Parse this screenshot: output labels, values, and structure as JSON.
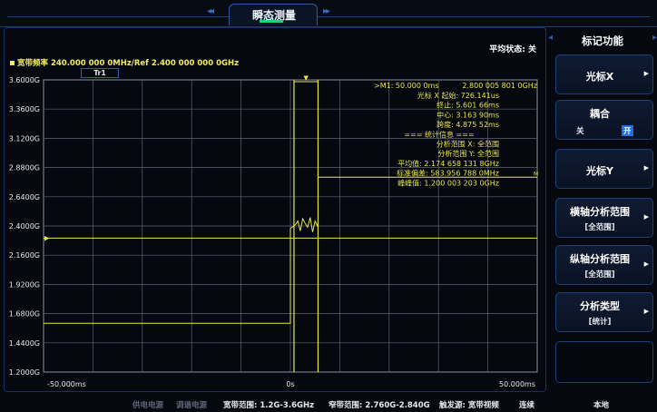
{
  "window": {
    "title": "瞬态测量"
  },
  "chart_header": {
    "avg_status": "平均状态: 关",
    "span_text": "宽带频率 240.000 000 0MHz/Ref 2.400 000 000 0GHz",
    "trace_label": "Tr1"
  },
  "chart_data": {
    "type": "line",
    "y_ticks": [
      "3.6000G",
      "3.3600G",
      "3.1200G",
      "2.8800G",
      "2.6400G",
      "2.4000G",
      "2.1600G",
      "1.9200G",
      "1.6800G",
      "1.4400G",
      "1.2000G"
    ],
    "x_ticks": [
      "-50.000ms",
      "0s",
      "50.000ms"
    ],
    "x_range_ms": [
      -50,
      50
    ],
    "y_range_ghz": [
      1.2,
      3.6
    ],
    "grid": true,
    "reference_line_ghz": 2.3,
    "series": [
      {
        "x_ms": [
          -50,
          0,
          0,
          1,
          1.5,
          2,
          2.5,
          3,
          3.5,
          4,
          4.5,
          5,
          5.5,
          5.6,
          5.6,
          50
        ],
        "y_ghz": [
          1.6,
          1.6,
          2.38,
          2.41,
          2.44,
          2.36,
          2.46,
          2.42,
          2.39,
          2.47,
          2.35,
          2.44,
          2.4,
          2.42,
          2.8,
          2.8
        ]
      }
    ],
    "cursor_lines_ms": [
      0.726,
      5.602
    ]
  },
  "marker_info": {
    "m1_time": ">M1: 50.000 0ms",
    "m1_freq": "2.800 005 801 0GHz",
    "lines": [
      "光标 X 起始: 726.141us",
      "终止: 5.601 66ms",
      "中心: 3.163 90ms",
      "跨度: 4.875 52ms",
      "=== 统计信息 ===",
      "分析范围 X: 全范围",
      "分析范围 Y: 全范围",
      "平均值: 2.174 658 131 8GHz",
      "标准偏差: 583.956 788 0MHz",
      "峰峰值: 1.200 003 203 0GHz"
    ]
  },
  "sidebar": {
    "title": "标记功能",
    "buttons": [
      {
        "label": "光标X"
      },
      {
        "label": "耦合",
        "off": "关",
        "on": "开"
      },
      {
        "label": "光标Y"
      },
      {
        "label": "横轴分析范围",
        "value": "[全范围]"
      },
      {
        "label": "纵轴分析范围",
        "value": "[全范围]"
      },
      {
        "label": "分析类型",
        "value": "[统计]"
      }
    ]
  },
  "status_bar": {
    "power_1": "供电电源",
    "power_2": "调谐电源",
    "wideband": "宽带范围: 1.2G-3.6GHz",
    "narrowband": "窄带范围: 2.760G-2.840G",
    "trigger": "触发源: 宽带视频",
    "sweep": "连续",
    "mode": "本地"
  },
  "colors": {
    "trace": "#e8e64e",
    "grid": "#5f6470",
    "accent": "#1f6fe0",
    "indicator": "#22d27a"
  }
}
